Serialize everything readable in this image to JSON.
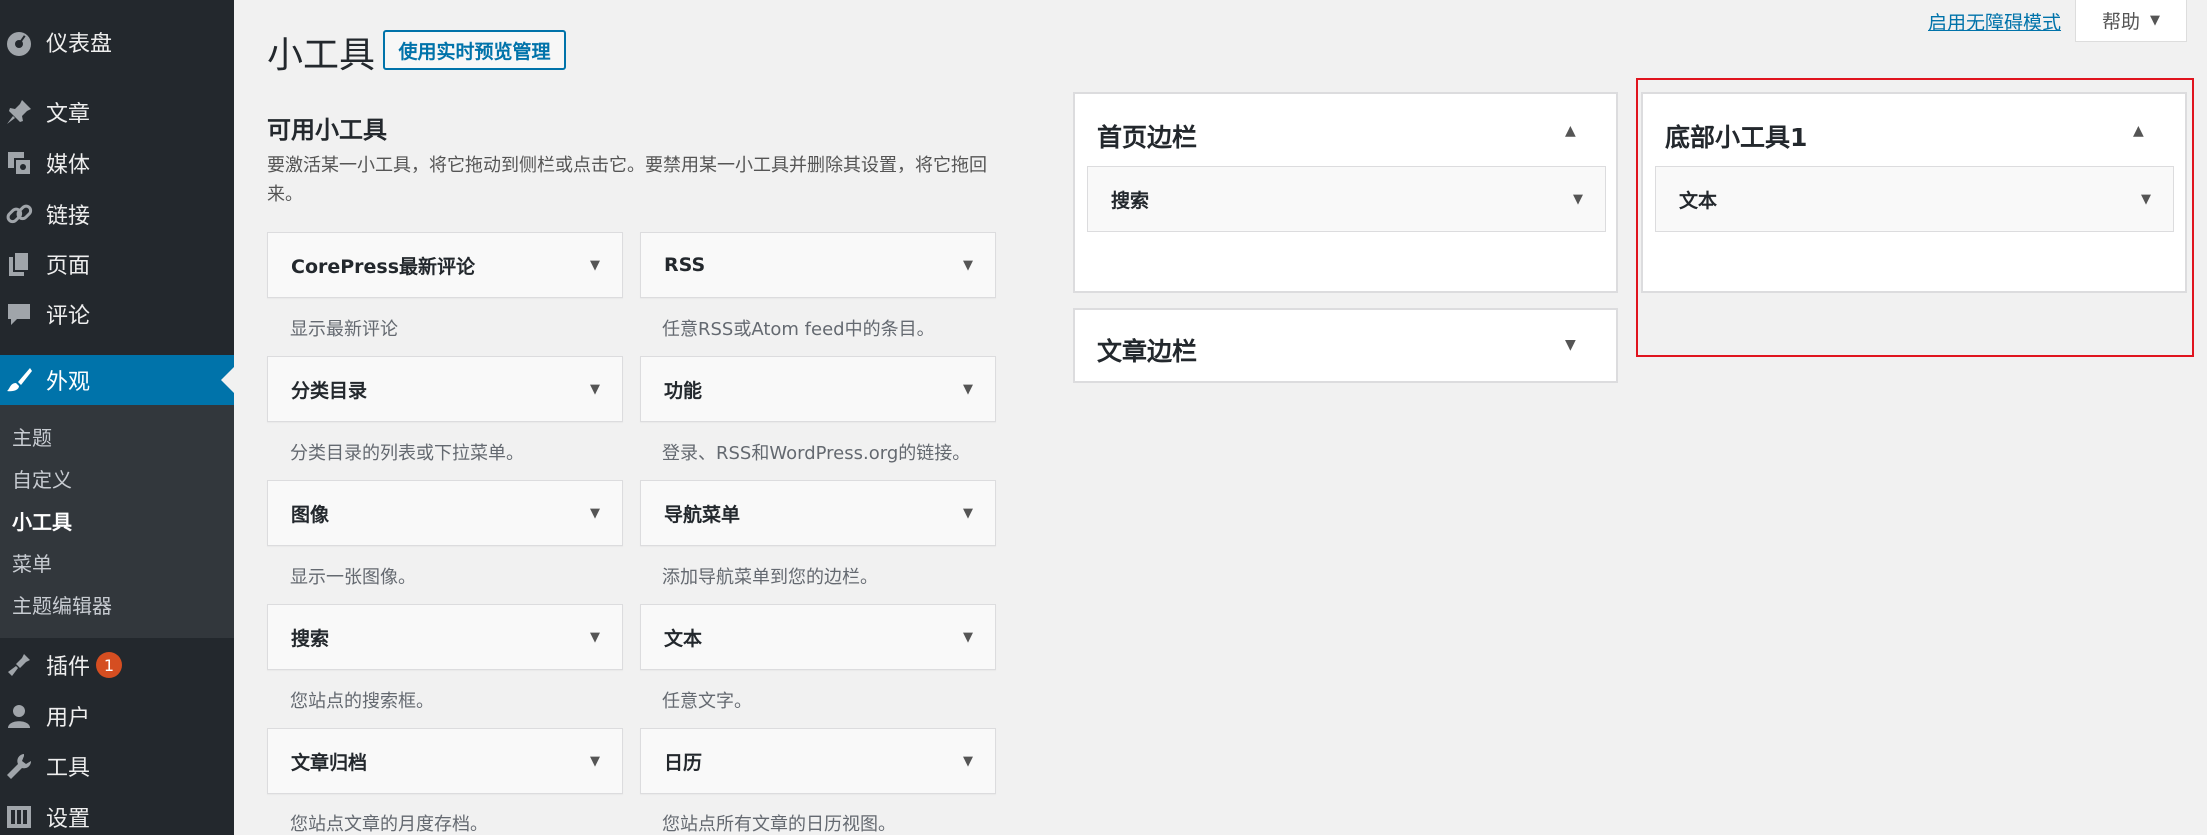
{
  "sidebar": {
    "menu": [
      {
        "label": "仪表盘",
        "icon": "dashboard-icon"
      },
      {
        "label": "文章",
        "icon": "pin-icon"
      },
      {
        "label": "媒体",
        "icon": "media-icon"
      },
      {
        "label": "链接",
        "icon": "link-icon"
      },
      {
        "label": "页面",
        "icon": "page-icon"
      },
      {
        "label": "评论",
        "icon": "comment-icon"
      },
      {
        "label": "外观",
        "icon": "brush-icon"
      },
      {
        "label": "插件",
        "icon": "plugin-icon"
      },
      {
        "label": "用户",
        "icon": "user-icon"
      },
      {
        "label": "工具",
        "icon": "wrench-icon"
      },
      {
        "label": "设置",
        "icon": "settings-icon"
      }
    ],
    "submenu": [
      "主题",
      "自定义",
      "小工具",
      "菜单",
      "主题编辑器"
    ],
    "plugins_badge": "1",
    "active_color": "#0073aa"
  },
  "header": {
    "title": "小工具",
    "live_preview_label": "使用实时预览管理",
    "a11y_link": "启用无障碍模式",
    "help_label": "帮助"
  },
  "available": {
    "title": "可用小工具",
    "description": "要激活某一小工具，将它拖动到侧栏或点击它。要禁用某一小工具并删除其设置，将它拖回来。",
    "widgets": [
      {
        "title": "CorePress最新评论",
        "desc": "显示最新评论"
      },
      {
        "title": "RSS",
        "desc": "任意RSS或Atom feed中的条目。"
      },
      {
        "title": "分类目录",
        "desc": "分类目录的列表或下拉菜单。"
      },
      {
        "title": "功能",
        "desc": "登录、RSS和WordPress.org的链接。"
      },
      {
        "title": "图像",
        "desc": "显示一张图像。"
      },
      {
        "title": "导航菜单",
        "desc": "添加导航菜单到您的边栏。"
      },
      {
        "title": "搜索",
        "desc": "您站点的搜索框。"
      },
      {
        "title": "文本",
        "desc": "任意文字。"
      },
      {
        "title": "文章归档",
        "desc": "您站点文章的月度存档。"
      },
      {
        "title": "日历",
        "desc": "您站点所有文章的日历视图。"
      }
    ]
  },
  "areas": {
    "home": {
      "title": "首页边栏",
      "widget": "搜索"
    },
    "post": {
      "title": "文章边栏"
    },
    "footer": {
      "title": "底部小工具1",
      "widget": "文本"
    }
  },
  "highlight_color": "#e0141e"
}
